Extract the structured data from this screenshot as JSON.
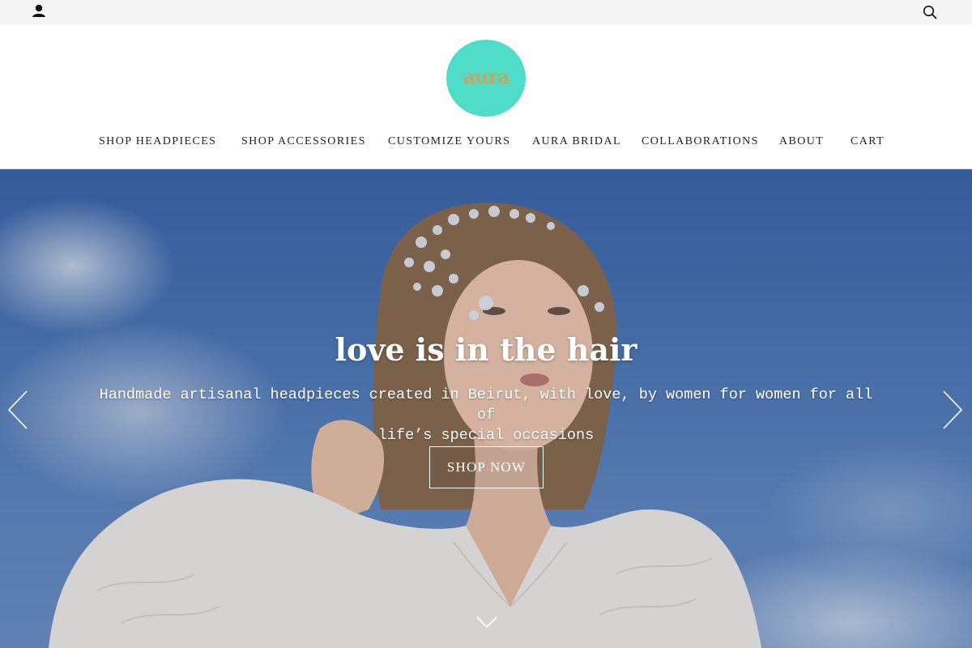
{
  "topbar": {
    "account_icon": "user-icon",
    "search_icon": "search-icon"
  },
  "brand": {
    "logo_text": "aura",
    "logo_color": "#4fdcc8",
    "logo_text_color": "#c5a760"
  },
  "nav": {
    "items": [
      {
        "label": "SHOP HEADPIECES"
      },
      {
        "label": "SHOP ACCESSORIES"
      },
      {
        "label": "CUSTOMIZE YOURS"
      },
      {
        "label": "AURA BRIDAL"
      },
      {
        "label": "COLLABORATIONS"
      },
      {
        "label": "ABOUT"
      },
      {
        "label": "CART"
      }
    ]
  },
  "hero": {
    "title": "love is in the hair",
    "subtitle_line1": "Handmade artisanal headpieces created in Beirut, with love, by women for women for all of",
    "subtitle_line2": "life’s special occasions",
    "cta_label": "SHOP NOW",
    "prev_icon": "chevron-left-icon",
    "next_icon": "chevron-right-icon",
    "scroll_icon": "chevron-down-icon"
  }
}
